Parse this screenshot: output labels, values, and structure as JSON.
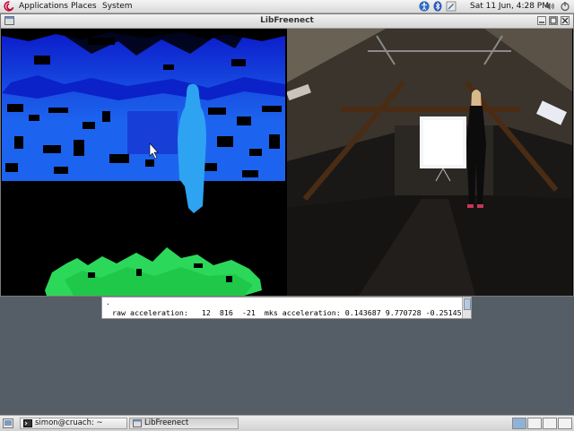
{
  "top_panel": {
    "menus": [
      "Applications",
      "Places",
      "System"
    ],
    "clock": "Sat 11 Jun,  4:28 PM",
    "tray_icons": [
      "accessibility-icon",
      "bluetooth-icon",
      "edit-icon",
      "volume-icon"
    ]
  },
  "window": {
    "title": "LibFreenect",
    "buttons": [
      "minimize-button",
      "maximize-button",
      "close-button"
    ]
  },
  "terminal": {
    "prev_line": ".",
    "line": " raw acceleration:   12  816  -21  mks acceleration: 0.143687 9.770728 -0.251453"
  },
  "bottom_panel": {
    "tasks": [
      {
        "label": "simon@cruach: ~",
        "icon": "terminal-icon"
      },
      {
        "label": "LibFreenect",
        "icon": "window-icon"
      }
    ],
    "workspaces": 4
  },
  "colors": {
    "depth_far": "#0a1ed8",
    "depth_mid": "#1f6af0",
    "depth_near": "#2ea0f5",
    "depth_floor": "#2adf4a",
    "panel_bg": "#d9d9d9",
    "desktop_bg": "#555d66"
  }
}
